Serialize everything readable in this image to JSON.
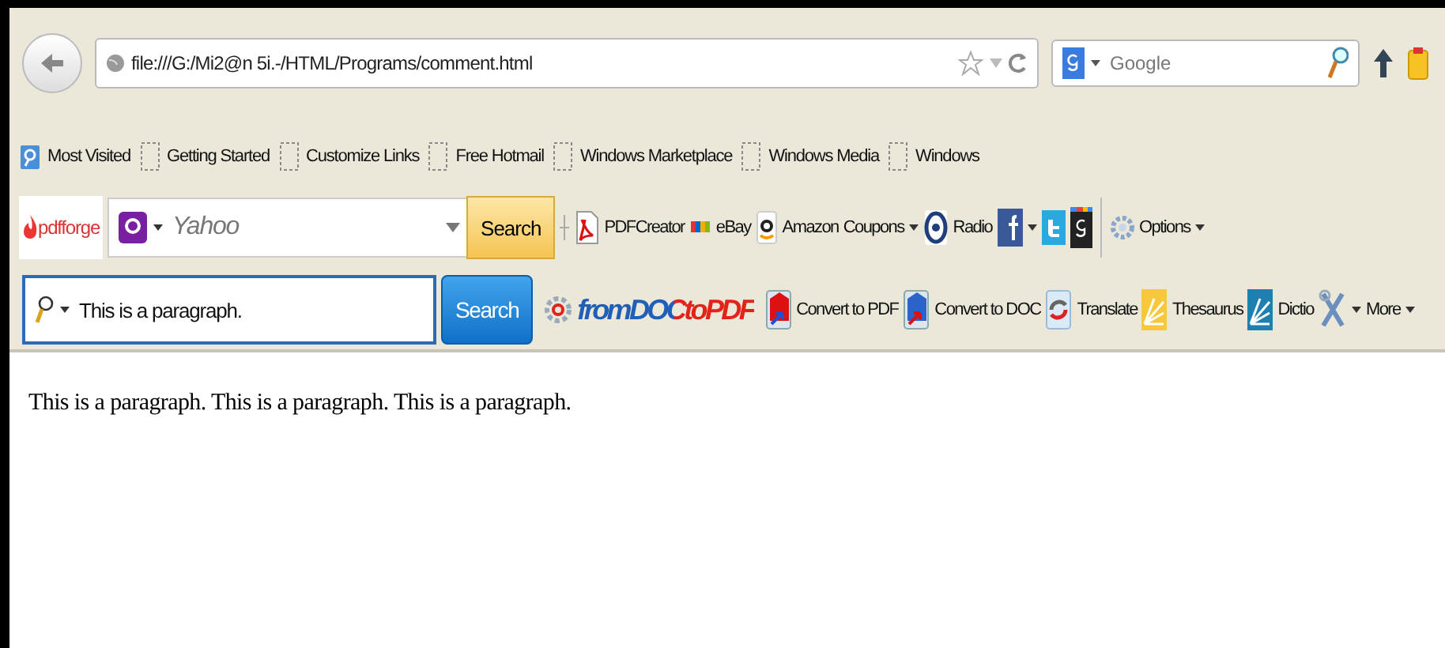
{
  "navigation": {
    "url": "file:///G:/Mi2@n 5i.-/HTML/Programs/comment.html",
    "search_placeholder": "Google"
  },
  "bookmarks": [
    {
      "label": "Most Visited",
      "kind": "folder"
    },
    {
      "label": "Getting Started",
      "kind": "page"
    },
    {
      "label": "Customize Links",
      "kind": "page"
    },
    {
      "label": "Free Hotmail",
      "kind": "page"
    },
    {
      "label": "Windows Marketplace",
      "kind": "page"
    },
    {
      "label": "Windows Media",
      "kind": "page"
    },
    {
      "label": "Windows",
      "kind": "page"
    }
  ],
  "pdfforge_toolbar": {
    "logo": "pdfforge",
    "search_placeholder": "Yahoo",
    "search_button": "Search",
    "items": [
      {
        "kind": "pdf",
        "label": "PDFCreator",
        "dropdown": false
      },
      {
        "kind": "ebay",
        "label": "eBay",
        "dropdown": false
      },
      {
        "kind": "amazon",
        "label": "Amazon",
        "dropdown": false
      },
      {
        "kind": "text",
        "label": "Coupons",
        "dropdown": true
      },
      {
        "kind": "radio",
        "label": "Radio",
        "dropdown": false
      },
      {
        "kind": "facebook",
        "dropdown": true
      },
      {
        "kind": "twitter",
        "dropdown": false
      },
      {
        "kind": "gplus",
        "dropdown": false
      },
      {
        "kind": "separator"
      },
      {
        "kind": "gear",
        "label": "Options",
        "dropdown": true
      }
    ]
  },
  "fromdoctopdf_toolbar": {
    "search_value": "This is a paragraph.",
    "search_button": "Search",
    "logo": "fromDOCtoPDF",
    "items": [
      {
        "kind": "convert-pdf",
        "label": "Convert to PDF",
        "dropdown": false
      },
      {
        "kind": "convert-doc",
        "label": "Convert to DOC",
        "dropdown": false
      },
      {
        "kind": "translate",
        "label": "Translate",
        "dropdown": false
      },
      {
        "kind": "thesaurus",
        "label": "Thesaurus",
        "dropdown": false
      },
      {
        "kind": "dictionary",
        "label": "Dictio",
        "dropdown": false
      },
      {
        "kind": "tools",
        "dropdown": true
      },
      {
        "kind": "text",
        "label": "More",
        "dropdown": true
      }
    ]
  },
  "page": {
    "paragraph": "This is a paragraph. This is a paragraph. This is a paragraph."
  }
}
